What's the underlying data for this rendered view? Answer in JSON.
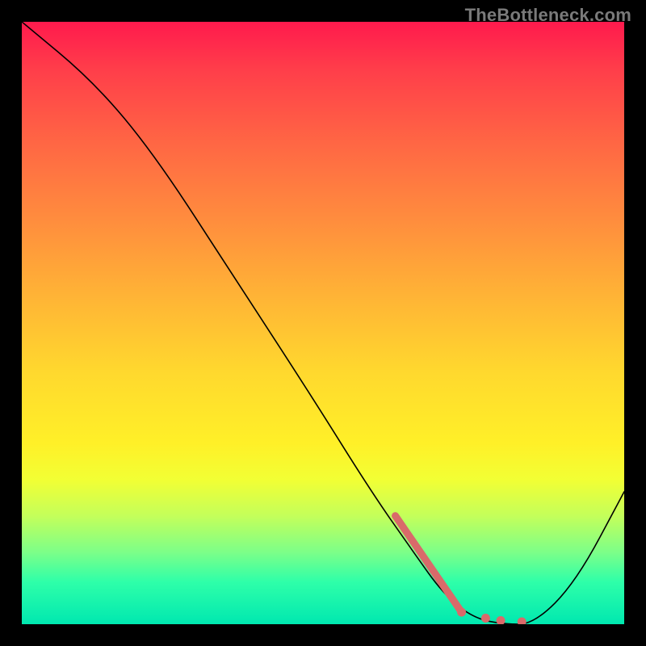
{
  "watermark": "TheBottleneck.com",
  "chart_data": {
    "type": "line",
    "title": "",
    "xlabel": "",
    "ylabel": "",
    "xlim": [
      0,
      100
    ],
    "ylim": [
      0,
      100
    ],
    "series": [
      {
        "name": "curve",
        "x": [
          0,
          12,
          22,
          35,
          48,
          58,
          65,
          70,
          75,
          80,
          85,
          92,
          100
        ],
        "y": [
          100,
          90,
          78,
          58,
          38,
          22,
          12,
          5,
          1,
          0,
          0,
          7,
          22
        ]
      }
    ],
    "markers": {
      "segment": {
        "x0": 62,
        "y0": 18,
        "x1": 73,
        "y1": 2
      },
      "dots": [
        {
          "x": 73,
          "y": 2
        },
        {
          "x": 77,
          "y": 1
        },
        {
          "x": 79.5,
          "y": 0.6
        },
        {
          "x": 83,
          "y": 0.4
        }
      ]
    },
    "background_gradient": {
      "top": "#ff1a4d",
      "bottom": "#00e8b0"
    }
  }
}
